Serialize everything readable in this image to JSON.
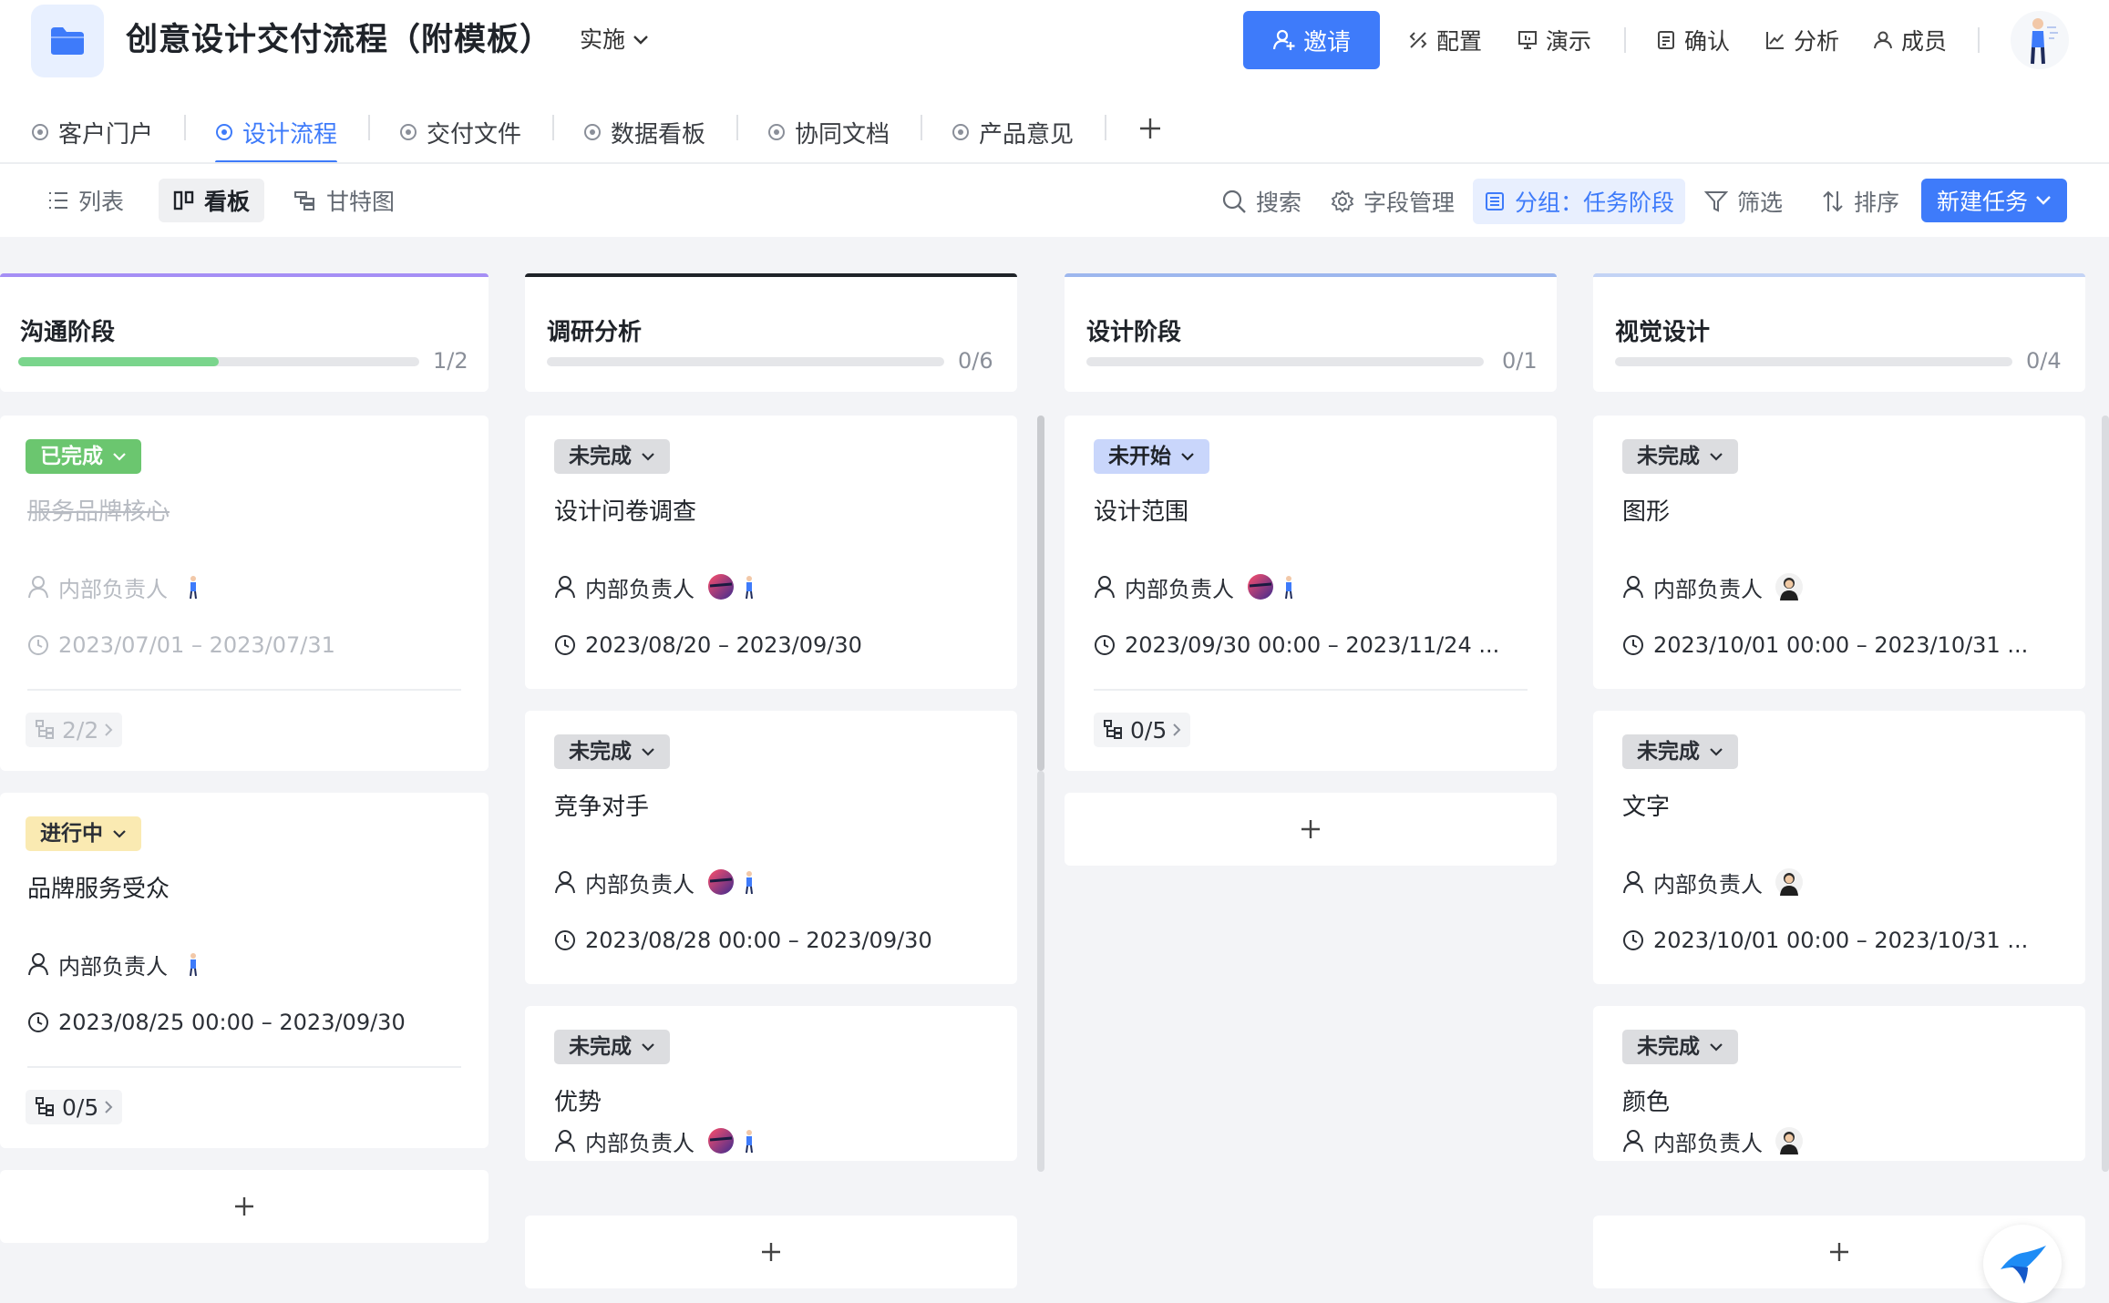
{
  "header": {
    "title": "创意设计交付流程（附模板）",
    "status": "实施",
    "invite_label": "邀请",
    "tools": [
      {
        "label": "配置",
        "icon": "config-icon"
      },
      {
        "label": "演示",
        "icon": "present-icon"
      },
      {
        "label": "确认",
        "icon": "confirm-icon"
      },
      {
        "label": "分析",
        "icon": "analysis-icon"
      },
      {
        "label": "成员",
        "icon": "members-icon"
      }
    ]
  },
  "tabs": [
    {
      "label": "客户门户"
    },
    {
      "label": "设计流程",
      "active": true
    },
    {
      "label": "交付文件"
    },
    {
      "label": "数据看板"
    },
    {
      "label": "协同文档"
    },
    {
      "label": "产品意见"
    }
  ],
  "toolbar": {
    "views": [
      "列表",
      "看板",
      "甘特图"
    ],
    "active_view": "看板",
    "search": "搜索",
    "fields": "字段管理",
    "group": "分组：任务阶段",
    "filter": "筛选",
    "sort": "排序",
    "new_task": "新建任务"
  },
  "colors": {
    "accent": "#3e7bfa",
    "done": "#6bc66f",
    "progress_fill": "#7ad58c"
  },
  "columns": [
    {
      "name": "沟通阶段",
      "count": "1/2",
      "progress": 0.5,
      "accent": "#a58ef5",
      "cards": [
        {
          "status": "已完成",
          "title": "服务品牌核心",
          "assignee": "内部负责人",
          "date": "2023/07/01 – 2023/07/31",
          "subtasks": "2/2"
        },
        {
          "status": "进行中",
          "title": "品牌服务受众",
          "assignee": "内部负责人",
          "date": "2023/08/25 00:00 – 2023/09/30",
          "subtasks": "0/5"
        }
      ]
    },
    {
      "name": "调研分析",
      "count": "0/6",
      "progress": 0,
      "accent": "#1f2329",
      "cards": [
        {
          "status": "未完成",
          "title": "设计问卷调查",
          "assignee": "内部负责人",
          "date": "2023/08/20 – 2023/09/30"
        },
        {
          "status": "未完成",
          "title": "竞争对手",
          "assignee": "内部负责人",
          "date": "2023/08/28 00:00 – 2023/09/30"
        },
        {
          "status": "未完成",
          "title": "优势",
          "assignee": "内部负责人"
        }
      ]
    },
    {
      "name": "设计阶段",
      "count": "0/1",
      "progress": 0,
      "accent": "#9db7ee",
      "cards": [
        {
          "status": "未开始",
          "title": "设计范围",
          "assignee": "内部负责人",
          "date": "2023/09/30 00:00 – 2023/11/24 ...",
          "subtasks": "0/5"
        }
      ]
    },
    {
      "name": "视觉设计",
      "count": "0/4",
      "progress": 0,
      "accent": "#c3d3f5",
      "cards": [
        {
          "status": "未完成",
          "title": "图形",
          "assignee": "内部负责人",
          "date": "2023/10/01 00:00 – 2023/10/31 ..."
        },
        {
          "status": "未完成",
          "title": "文字",
          "assignee": "内部负责人",
          "date": "2023/10/01 00:00 – 2023/10/31 ..."
        },
        {
          "status": "未完成",
          "title": "颜色",
          "assignee": "内部负责人"
        }
      ]
    }
  ]
}
